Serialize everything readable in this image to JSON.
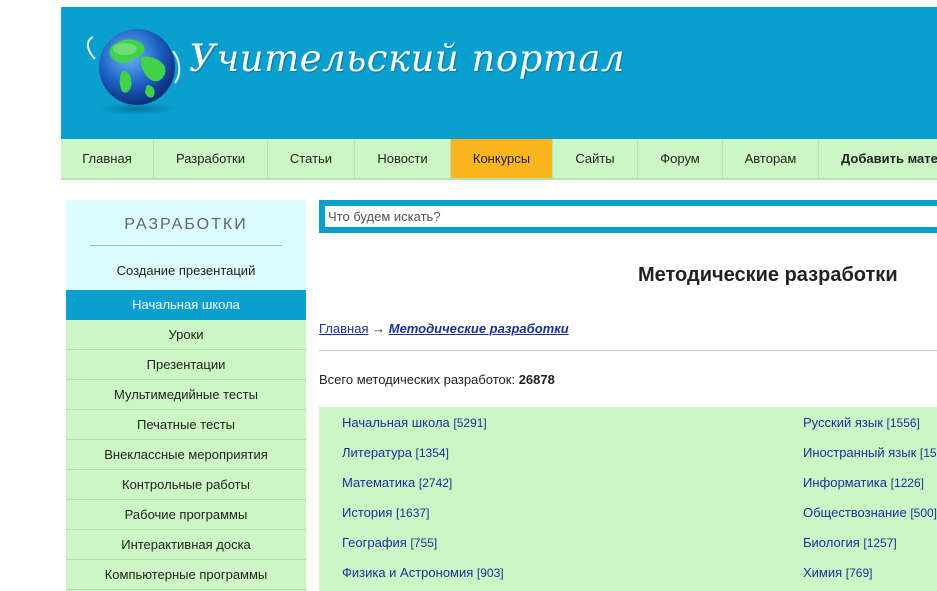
{
  "header": {
    "site_title": "Учительский портал",
    "brand_color": "#0a9fcf"
  },
  "nav": {
    "items": [
      {
        "label": "Главная"
      },
      {
        "label": "Разработки"
      },
      {
        "label": "Статьи"
      },
      {
        "label": "Новости"
      },
      {
        "label": "Конкурсы",
        "active": true
      },
      {
        "label": "Сайты"
      },
      {
        "label": "Форум"
      },
      {
        "label": "Авторам"
      },
      {
        "label": "Добавить мате"
      }
    ],
    "active_color": "#fbb51e"
  },
  "sidebar": {
    "title": "РАЗРАБОТКИ",
    "subtitle_link": "Создание презентаций",
    "active_item": "Начальная школа",
    "items": [
      "Уроки",
      "Презентации",
      "Мультимедийные тесты",
      "Печатные тесты",
      "Внеклассные мероприятия",
      "Контрольные работы",
      "Рабочие программы",
      "Интерактивная доска",
      "Компьютерные программы"
    ]
  },
  "search": {
    "placeholder": "Что будем искать?",
    "value": ""
  },
  "main": {
    "page_title": "Методические разработки",
    "breadcrumb": {
      "home": "Главная",
      "separator": "→",
      "current": "Методические разработки"
    },
    "total_label": "Всего методических разработок:",
    "total_value": "26878",
    "categories_left": [
      {
        "name": "Начальная школа",
        "count": "[5291]"
      },
      {
        "name": "Литература",
        "count": "[1354]"
      },
      {
        "name": "Математика",
        "count": "[2742]"
      },
      {
        "name": "История",
        "count": "[1637]"
      },
      {
        "name": "География",
        "count": "[755]"
      },
      {
        "name": "Физика и Астрономия",
        "count": "[903]"
      }
    ],
    "categories_right": [
      {
        "name": "Русский язык",
        "count": "[1556]"
      },
      {
        "name": "Иностранный язык",
        "count": "[15"
      },
      {
        "name": "Информатика",
        "count": "[1226]"
      },
      {
        "name": "Обществознание",
        "count": "[500]"
      },
      {
        "name": "Биология",
        "count": "[1257]"
      },
      {
        "name": "Химия",
        "count": "[769]"
      }
    ]
  }
}
